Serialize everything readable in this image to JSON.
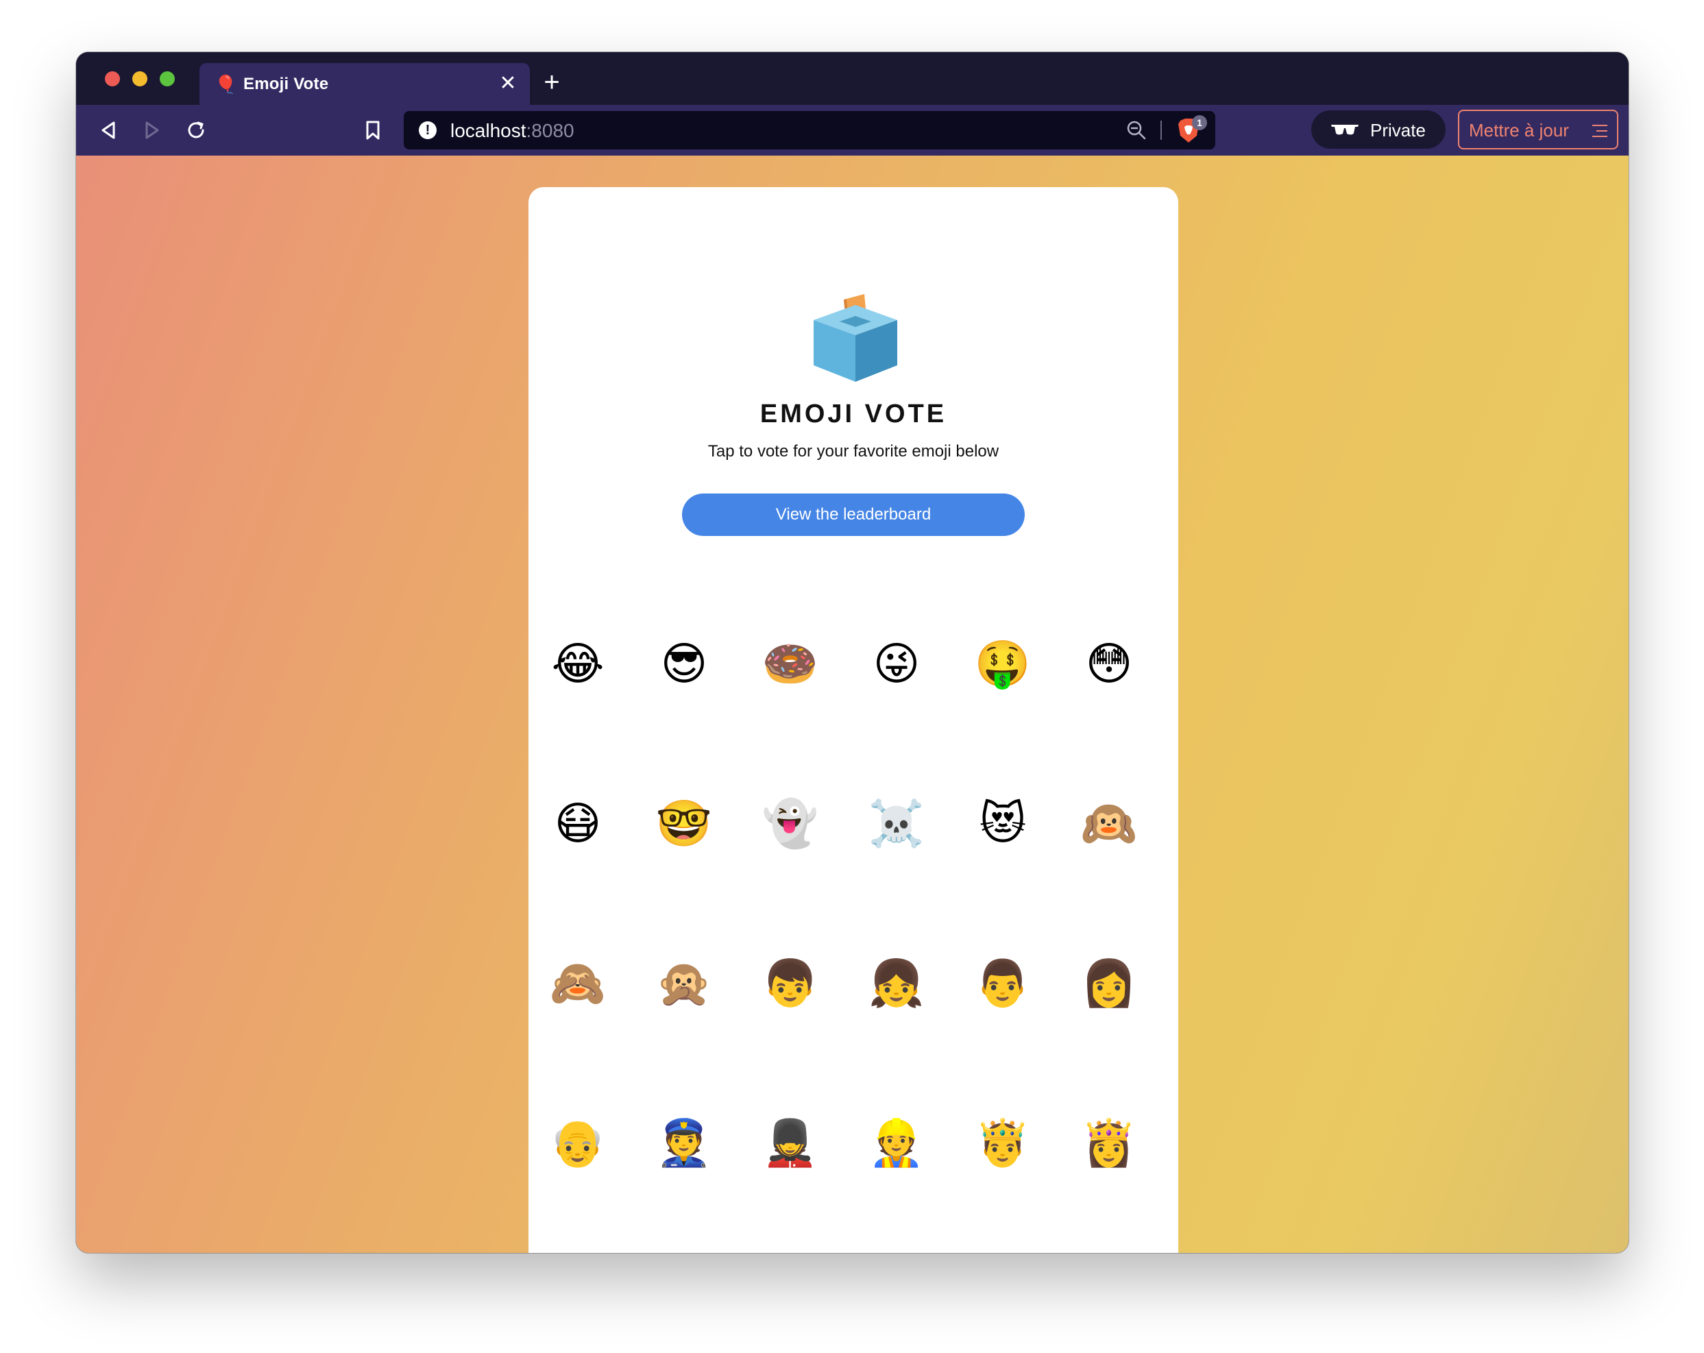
{
  "browser": {
    "tab_title": "Emoji Vote",
    "tab_favicon": "🎈",
    "close_glyph": "✕",
    "new_tab_glyph": "+",
    "url_host": "localhost",
    "url_port": ":8080",
    "url_info_glyph": "!",
    "shield_count": "1",
    "private_label": "Private",
    "update_label": "Mettre à jour"
  },
  "colors": {
    "window_chrome": "#1a1830",
    "toolbar": "#332a62",
    "accent_button": "#4585e6",
    "update_accent": "#f0836f"
  },
  "page": {
    "logo_icon": "ballot-box-icon",
    "title": "EMOJI VOTE",
    "subtitle": "Tap to vote for your favorite emoji below",
    "leaderboard_button": "View the leaderboard",
    "emojis": [
      [
        "😂",
        "😎",
        "🍩",
        "😜",
        "🤑",
        "😳"
      ],
      [
        "😷",
        "🤓",
        "👻",
        "☠️",
        "😻",
        "🙉"
      ],
      [
        "🙈",
        "🙊",
        "👦",
        "👧",
        "👨",
        "👩"
      ],
      [
        "👴",
        "👮",
        "💂",
        "👷",
        "🤴",
        "👸"
      ]
    ]
  }
}
